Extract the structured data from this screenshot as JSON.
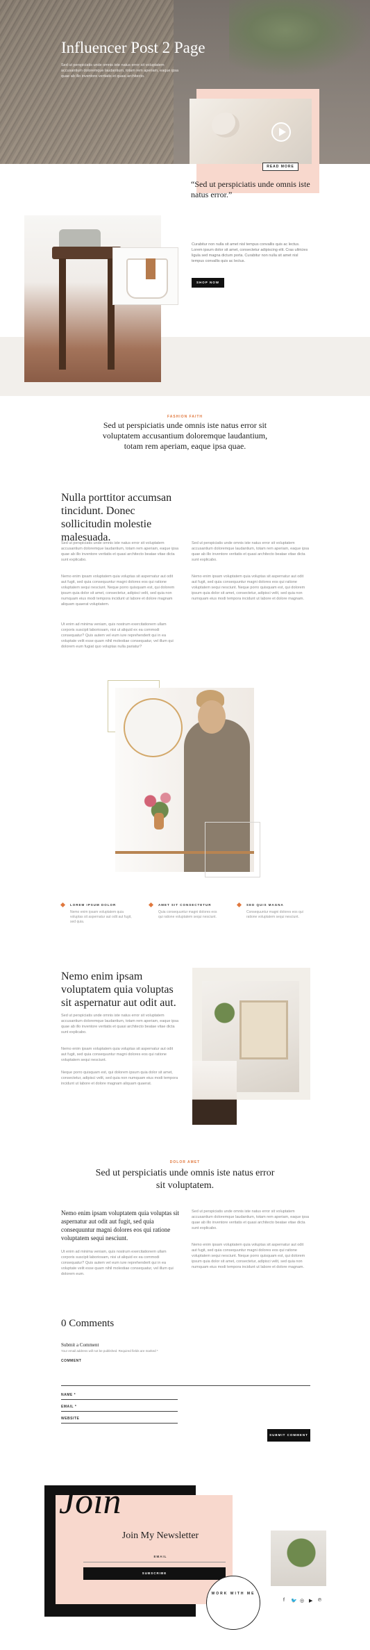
{
  "hero": {
    "title": "Influencer Post 2 Page",
    "subtitle": "Sed ut perspiciatis unde omnis iste natus error sit voluptatem accusantium doloremque laudantium, totam rem aperiam, eaque ipsa quae ab illo inventore veritatis et quasi architecto."
  },
  "feature": {
    "read_more": "READ MORE",
    "quote": "“Sed ut perspiciatis unde omnis iste natus error.”"
  },
  "product": {
    "text": "Curabitur non nulla sit amet nisl tempus convallis quis ac lectus. Lorem ipsum dolor sit amet, consectetur adipiscing elit. Cras ultricies ligula sed magna dictum porta. Curabitur non nulla sit amet nisl tempus convallis quis ac lectus.",
    "button": "SHOP NOW"
  },
  "section1": {
    "eyebrow": "FASHION FAITH",
    "heading": "Sed ut perspiciatis unde omnis iste natus error sit voluptatem accusantium doloremque laudantium, totam rem aperiam, eaque ipsa quae."
  },
  "article1": {
    "heading": "Nulla porttitor accumsan tincidunt. Donec sollicitudin molestie malesuada.",
    "left_p1": "Sed ut perspiciatis unde omnis iste natus error sit voluptatem accusantium doloremque laudantium, totam rem aperiam, eaque ipsa quae ab illo inventore veritatis et quasi architecto beatae vitae dicta sunt explicabo.",
    "left_p2": "Nemo enim ipsam voluptatem quia voluptas sit aspernatur aut odit aut fugit, sed quia consequuntur magni dolores eos qui ratione voluptatem sequi nesciunt. Neque porro quisquam est, qui dolorem ipsum quia dolor sit amet, consectetur, adipisci velit, sed quia non numquam eius modi tempora incidunt ut labore et dolore magnam aliquam quaerat voluptatem.",
    "left_p3": "Ut enim ad minima veniam, quis nostrum exercitationem ullam corporis suscipit laboriosam, nisi ut aliquid ex ea commodi consequatur? Quis autem vel eum iure reprehenderit qui in ea voluptate velit esse quam nihil molestiae consequatur, vel illum qui dolorem eum fugiat quo voluptas nulla pariatur?",
    "right_p1": "Sed ut perspiciatis unde omnis iste natus error sit voluptatem accusantium doloremque laudantium, totam rem aperiam, eaque ipsa quae ab illo inventore veritatis et quasi architecto beatae vitae dicta sunt explicabo.",
    "right_p2": "Nemo enim ipsam voluptatem quia voluptas sit aspernatur aut odit aut fugit, sed quia consequuntur magni dolores eos qui ratione voluptatem sequi nesciunt. Neque porro quisquam est, qui dolorem ipsum quia dolor sit amet, consectetur, adipisci velit, sed quia non numquam eius modi tempora incidunt ut labore et dolore magnam."
  },
  "features": [
    {
      "title": "LOREM IPSUM DOLOR",
      "text": "Nemo enim ipsam voluptatem quia voluptas sit aspernatur aut odit aut fugit, sed quia."
    },
    {
      "title": "AMET SIT CONSECTETUR",
      "text": "Quia consequuntur magni dolores eos qui ratione voluptatem sequi nesciunt."
    },
    {
      "title": "SED QUIS MAGNA",
      "text": "Consequuntur magni dolores eos qui ratione voluptatem sequi nesciunt."
    }
  ],
  "article2": {
    "heading": "Nemo enim ipsam voluptatem quia voluptas sit aspernatur aut odit aut.",
    "p1": "Sed ut perspiciatis unde omnis iste natus error sit voluptatem accusantium doloremque laudantium, totam rem aperiam, eaque ipsa quae ab illo inventore veritatis et quasi architecto beatae vitae dicta sunt explicabo.",
    "p2": "Nemo enim ipsam voluptatem quia voluptas sit aspernatur aut odit aut fugit, sed quia consequuntur magni dolores eos qui ratione voluptatem sequi nesciunt.",
    "p3": "Neque porro quisquam est, qui dolorem ipsum quia dolor sit amet, consectetur, adipisci velit, sed quia non numquam eius modi tempora incidunt ut labore et dolore magnam aliquam quaerat."
  },
  "section2": {
    "eyebrow": "DOLOR AMET",
    "heading": "Sed ut perspiciatis unde omnis iste natus error sit voluptatem."
  },
  "article3": {
    "quote": "Nemo enim ipsam voluptatem quia voluptas sit aspernatur aut odit aut fugit, sed quia consequuntur magni dolores eos qui ratione voluptatem sequi nesciunt.",
    "left_p": "Ut enim ad minima veniam, quis nostrum exercitationem ullam corporis suscipit laboriosam, nisi ut aliquid ex ea commodi consequatur? Quis autem vel eum iure reprehenderit qui in ea voluptate velit esse quam nihil molestiae consequatur, vel illum qui dolorem eum.",
    "right_p1": "Sed ut perspiciatis unde omnis iste natus error sit voluptatem accusantium doloremque laudantium, totam rem aperiam, eaque ipsa quae ab illo inventore veritatis et quasi architecto beatae vitae dicta sunt explicabo.",
    "right_p2": "Nemo enim ipsam voluptatem quia voluptas sit aspernatur aut odit aut fugit, sed quia consequuntur magni dolores eos qui ratione voluptatem sequi nesciunt. Neque porro quisquam est, qui dolorem ipsum quia dolor sit amet, consectetur, adipisci velit, sed quia non numquam eius modi tempora incidunt ut labore et dolore magnam."
  },
  "comments": {
    "heading": "0 Comments",
    "submit_title": "Submit a Comment",
    "notice": "Your email address will not be published. Required fields are marked *",
    "comment_label": "COMMENT",
    "name_label": "NAME *",
    "email_label": "EMAIL *",
    "website_label": "WEBSITE",
    "submit": "SUBMIT COMMENT"
  },
  "newsletter": {
    "join": "Join",
    "title": "Join My Newsletter",
    "email_label": "EMAIL",
    "button": "SUBSCRIBE",
    "work_with_me": "WORK WITH ME"
  },
  "social": [
    "f",
    "🐦",
    "◎",
    "▶",
    "℗"
  ],
  "colors": {
    "accent": "#e0783e",
    "pink": "#f8d8cd",
    "beige": "#f2efeb",
    "dark": "#111111"
  }
}
